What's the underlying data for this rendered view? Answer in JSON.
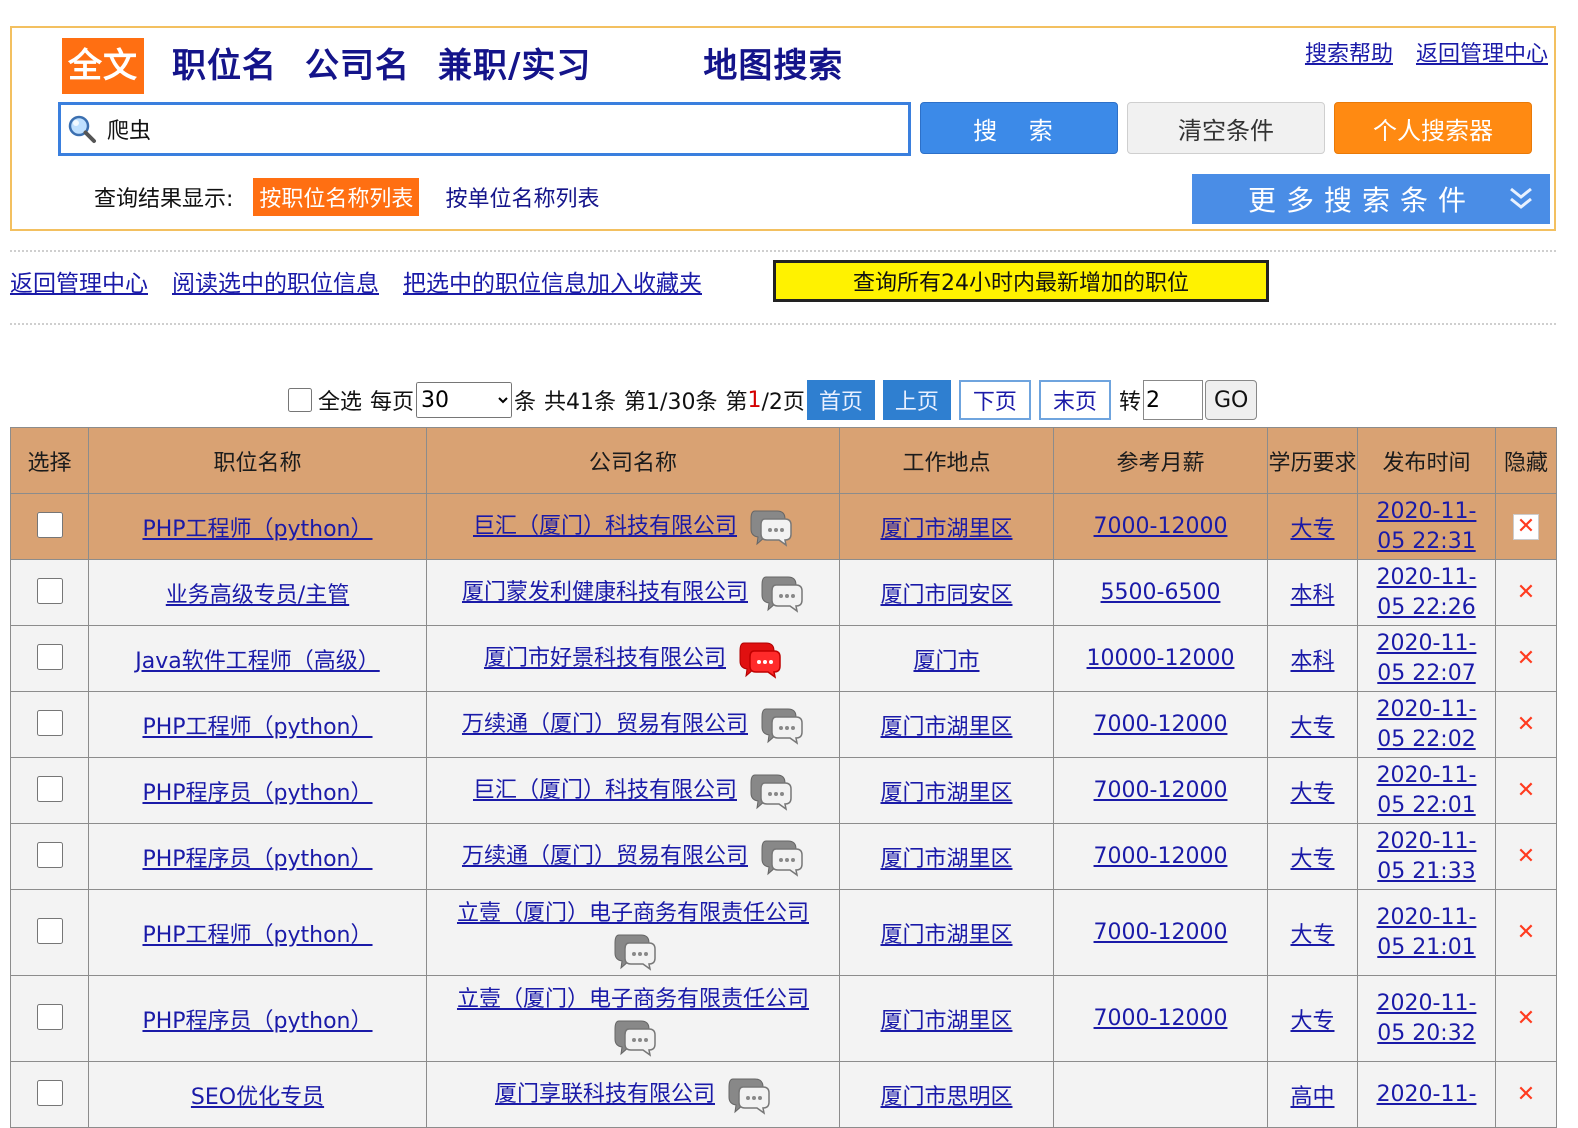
{
  "search": {
    "tabs": [
      "全文",
      "职位名",
      "公司名",
      "兼职/实习",
      "地图搜索"
    ],
    "help": [
      "搜索帮助",
      "返回管理中心"
    ],
    "query": "爬虫",
    "search_btn": "搜 索",
    "clear_btn": "清空条件",
    "personal_btn": "个人搜索器",
    "result_label": "查询结果显示:",
    "result_opts": [
      "按职位名称列表",
      "按单位名称列表"
    ],
    "more": "更多搜索条件"
  },
  "links": {
    "back": "返回管理中心",
    "read": "阅读选中的职位信息",
    "fav": "把选中的职位信息加入收藏夹",
    "latest": "查询所有24小时内最新增加的职位"
  },
  "pager": {
    "select_all": "全选",
    "per_page_label": "每页",
    "per_page": "30",
    "unit": "条",
    "total": "共41条",
    "range": "第1/30条",
    "page_prefix": "第",
    "page_cur": "1",
    "page_suffix": "/2页",
    "first": "首页",
    "prev": "上页",
    "next": "下页",
    "last": "末页",
    "goto_label": "转",
    "goto_value": "2",
    "go": "GO"
  },
  "table": {
    "headers": [
      "选择",
      "职位名称",
      "公司名称",
      "工作地点",
      "参考月薪",
      "学历要求",
      "发布时间",
      "隐藏"
    ],
    "rows": [
      {
        "title": "PHP工程师（python）",
        "company": "巨汇（厦门）科技有限公司",
        "location": "厦门市湖里区",
        "salary": "7000-12000",
        "edu": "大专",
        "date1": "2020-11-",
        "date2": "05 22:31"
      },
      {
        "title": "业务高级专员/主管",
        "company": "厦门蒙发利健康科技有限公司",
        "location": "厦门市同安区",
        "salary": "5500-6500",
        "edu": "本科",
        "date1": "2020-11-",
        "date2": "05 22:26"
      },
      {
        "title": "Java软件工程师（高级）",
        "company": "厦门市好景科技有限公司",
        "location": "厦门市",
        "salary": "10000-12000",
        "edu": "本科",
        "date1": "2020-11-",
        "date2": "05 22:07"
      },
      {
        "title": "PHP工程师（python）",
        "company": "万续通（厦门）贸易有限公司",
        "location": "厦门市湖里区",
        "salary": "7000-12000",
        "edu": "大专",
        "date1": "2020-11-",
        "date2": "05 22:02"
      },
      {
        "title": "PHP程序员（python）",
        "company": "巨汇（厦门）科技有限公司",
        "location": "厦门市湖里区",
        "salary": "7000-12000",
        "edu": "大专",
        "date1": "2020-11-",
        "date2": "05 22:01"
      },
      {
        "title": "PHP程序员（python）",
        "company": "万续通（厦门）贸易有限公司",
        "location": "厦门市湖里区",
        "salary": "7000-12000",
        "edu": "大专",
        "date1": "2020-11-",
        "date2": "05 21:33"
      },
      {
        "title": "PHP工程师（python）",
        "company": "立壹（厦门）电子商务有限责任公司",
        "location": "厦门市湖里区",
        "salary": "7000-12000",
        "edu": "大专",
        "date1": "2020-11-",
        "date2": "05 21:01"
      },
      {
        "title": "PHP程序员（python）",
        "company": "立壹（厦门）电子商务有限责任公司",
        "location": "厦门市湖里区",
        "salary": "7000-12000",
        "edu": "大专",
        "date1": "2020-11-",
        "date2": "05 20:32"
      },
      {
        "title": "SEO优化专员",
        "company": "厦门享联科技有限公司",
        "location": "厦门市思明区",
        "salary": "",
        "edu": "高中",
        "date1": "2020-11-",
        "date2": ""
      }
    ],
    "delete_glyph": "✕"
  }
}
